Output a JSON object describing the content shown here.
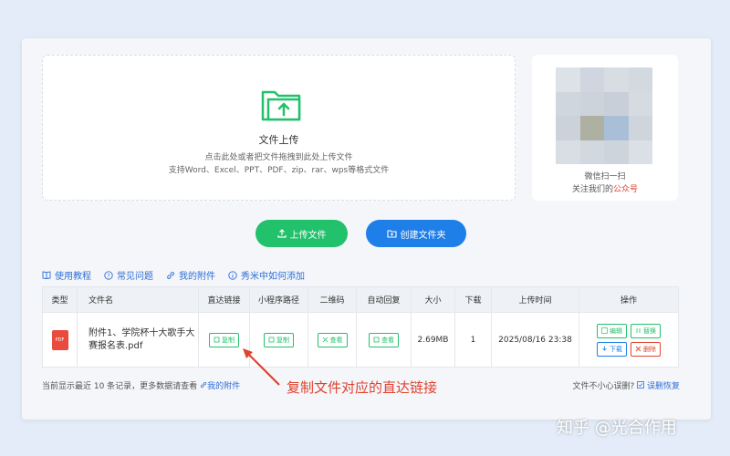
{
  "upload": {
    "title": "文件上传",
    "hint1": "点击此处或者把文件拖拽到此处上传文件",
    "hint2": "支持Word、Excel、PPT、PDF、zip、rar、wps等格式文件"
  },
  "qr": {
    "text1": "微信扫一扫",
    "text2_prefix": "关注我们的",
    "text2_highlight": "公众号"
  },
  "buttons": {
    "upload": "上传文件",
    "create_folder": "创建文件夹"
  },
  "links": [
    "使用教程",
    "常见问题",
    "我的附件",
    "秀米中如何添加"
  ],
  "table": {
    "headers": [
      "类型",
      "文件名",
      "直达链接",
      "小程序路径",
      "二维码",
      "自动回复",
      "大小",
      "下载",
      "上传时间",
      "操作"
    ],
    "rows": [
      {
        "type_icon": "PDF",
        "filename": "附件1、学院杯十大歌手大赛报名表.pdf",
        "direct_link": "复制",
        "mini_path": "复制",
        "qrcode": "查看",
        "auto_reply": "查看",
        "size": "2.69MB",
        "downloads": "1",
        "upload_time": "2025/08/16 23:38",
        "actions": [
          "编辑",
          "替换",
          "下载",
          "删除"
        ]
      }
    ]
  },
  "footer": {
    "left": "当前显示最近 10 条记录，更多数据请查看",
    "left_link": "我的附件",
    "right": "文件不小心误删?",
    "right_link": "误删恢复"
  },
  "annotation": "复制文件对应的直达链接",
  "watermark": "知乎 @光合作用",
  "colors": {
    "green": "#22c16b",
    "blue": "#1f7fe8",
    "red": "#e0432f"
  }
}
